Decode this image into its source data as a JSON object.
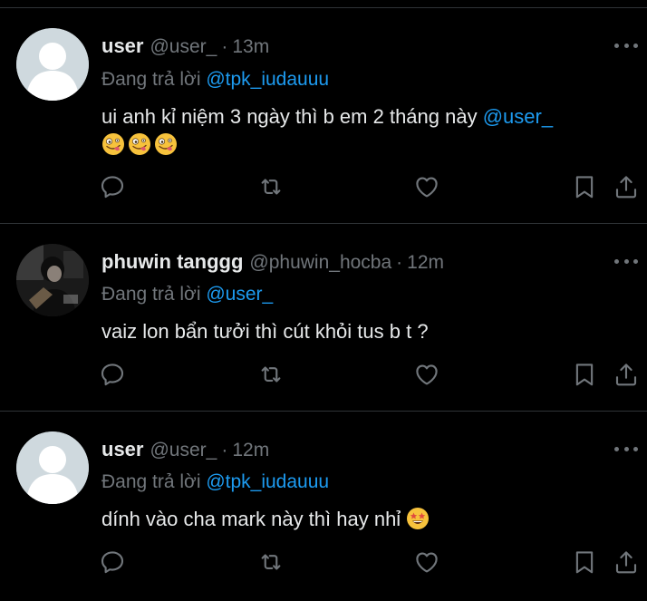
{
  "tweets": [
    {
      "name": "user",
      "handle": "@user_",
      "dot": "·",
      "time": "13m",
      "reply_prefix": "Đang trả lời ",
      "reply_to": "@tpk_iudauuu",
      "text": "ui anh kỉ niệm 3 ngày thì b em 2 tháng này ",
      "text_mention": "@user_",
      "emojis": [
        "zany-face",
        "zany-face",
        "zany-face"
      ],
      "avatar": "default-avatar"
    },
    {
      "name": "phuwin tanggg",
      "handle": "@phuwin_hocba",
      "dot": "·",
      "time": "12m",
      "reply_prefix": "Đang trả lời ",
      "reply_to": "@user_",
      "text": "vaiz lon bẩn tưởi thì cút khỏi tus b t ?",
      "avatar": "photo-avatar"
    },
    {
      "name": "user",
      "handle": "@user_",
      "dot": "·",
      "time": "12m",
      "reply_prefix": "Đang trả lời ",
      "reply_to": "@tpk_iudauuu",
      "text": "dính vào cha mark này thì hay nhỉ ",
      "emojis": [
        "star-struck-face"
      ],
      "avatar": "default-avatar"
    }
  ],
  "actions": [
    "reply-icon",
    "retweet-icon",
    "like-icon",
    "bookmark-icon",
    "share-icon"
  ],
  "colors": {
    "background": "#000000",
    "text": "#e7e9ea",
    "muted": "#71767b",
    "link": "#1d9bf0",
    "divider": "#2f3336"
  }
}
